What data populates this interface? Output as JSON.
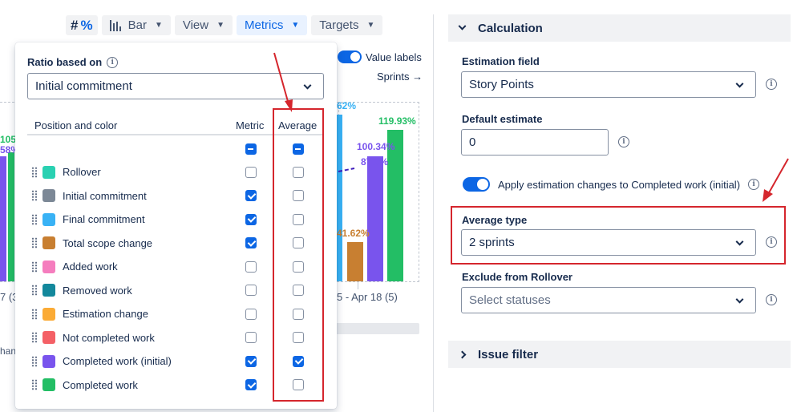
{
  "toolbar": {
    "hash_icon": "#",
    "percent_icon": "%",
    "chart_type": "Bar",
    "view": "View",
    "metrics": "Metrics",
    "targets": "Targets"
  },
  "chart_bg": {
    "value_labels": "Value labels",
    "sprints_link": "Sprints →",
    "labels": {
      "left_105": "105",
      "left_58": "58%",
      "pct_62": "62%",
      "pct_119": "119.93%",
      "pct_100": "100.34%",
      "pct_87": "87.5%",
      "pct_41": "41.62%"
    },
    "axis_left": "7 (3",
    "axis_right": "5 - Apr 18 (5)",
    "cut_text": "hang"
  },
  "panel": {
    "ratio_label": "Ratio based on",
    "ratio_value": "Initial commitment",
    "col_position": "Position and color",
    "col_metric": "Metric",
    "col_average": "Average",
    "header_metric_state": "indeterminate",
    "header_average_state": "indeterminate",
    "rows": [
      {
        "label": "Rollover",
        "color": "#2ad1b2",
        "metric": false,
        "average": false
      },
      {
        "label": "Initial commitment",
        "color": "#7c8896",
        "metric": true,
        "average": false
      },
      {
        "label": "Final commitment",
        "color": "#39b2f5",
        "metric": true,
        "average": false
      },
      {
        "label": "Total scope change",
        "color": "#c87f31",
        "metric": true,
        "average": false
      },
      {
        "label": "Added work",
        "color": "#f57dbe",
        "metric": false,
        "average": false
      },
      {
        "label": "Removed work",
        "color": "#13889c",
        "metric": false,
        "average": false
      },
      {
        "label": "Estimation change",
        "color": "#fbab36",
        "metric": false,
        "average": false
      },
      {
        "label": "Not completed work",
        "color": "#f46066",
        "metric": false,
        "average": false
      },
      {
        "label": "Completed work (initial)",
        "color": "#7954ed",
        "metric": true,
        "average": true
      },
      {
        "label": "Completed work",
        "color": "#23be65",
        "metric": true,
        "average": false
      }
    ]
  },
  "settings": {
    "calculation_title": "Calculation",
    "estimation_field_label": "Estimation field",
    "estimation_field_value": "Story Points",
    "default_estimate_label": "Default estimate",
    "default_estimate_value": "0",
    "apply_label": "Apply estimation changes to Completed work (initial)",
    "average_type_label": "Average type",
    "average_type_value": "2 sprints",
    "exclude_label": "Exclude from Rollover",
    "exclude_placeholder": "Select statuses",
    "issue_filter_title": "Issue filter"
  },
  "colors": {
    "accent": "#0c66e4",
    "annotation_red": "#d5262d",
    "bar_final": "#39b2f5",
    "bar_scope": "#c87f31",
    "bar_completed_initial": "#7954ed",
    "bar_completed": "#23be65"
  },
  "icons": [
    "hash-icon",
    "percent-icon",
    "bar-chart-icon",
    "chevron-down-icon",
    "info-icon",
    "drag-handle-icon",
    "chevron-right-icon",
    "arrow-right-icon"
  ]
}
